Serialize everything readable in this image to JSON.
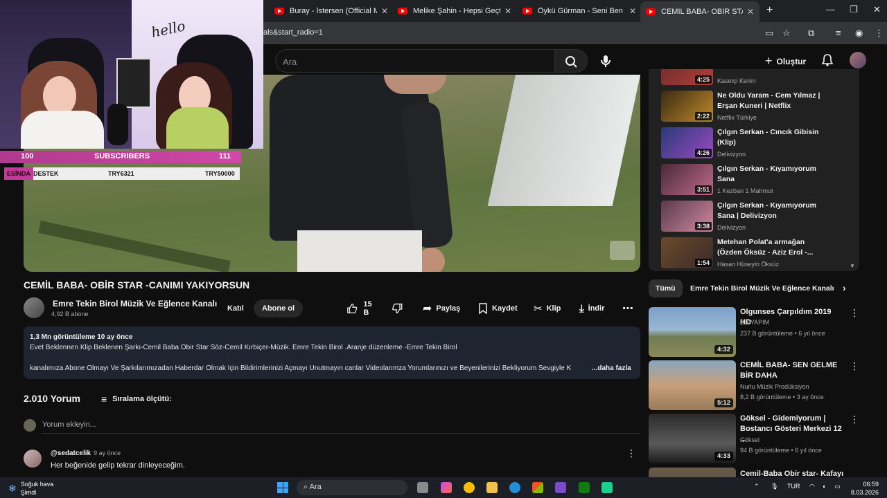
{
  "browser": {
    "tabs": [
      {
        "title": "Buray - İstersen (Official Music Video)"
      },
      {
        "title": "Melike Şahin - Hepsi Geçti | Karnaval"
      },
      {
        "title": "Öykü Gürman - Seni Ben Unutmam"
      },
      {
        "title": "CEMİL BABA- OBİR STAR -CANIMI"
      }
    ],
    "url": "als&start_radio=1"
  },
  "masthead": {
    "search_placeholder": "Ara",
    "create_label": "Oluştur"
  },
  "stream_overlay": {
    "hello_text": "hello",
    "subs_left": "100",
    "subs_label": "SUBSCRIBERS",
    "subs_right": "111",
    "destek_label": "ESİNDA",
    "destek_title": "DESTEK",
    "destek_mid": "TRY6321",
    "destek_right": "TRY50000"
  },
  "video": {
    "title": "CEMİL BABA- OBİR STAR -CANIMI YAKIYORSUN",
    "channel": "Emre Tekin Birol Müzik Ve Eğlence Kanalı",
    "subscribers": "4,92 B abone",
    "join_label": "Katıl",
    "subscribe_label": "Abone ol",
    "likes": "15 B",
    "share_label": "Paylaş",
    "save_label": "Kaydet",
    "clip_label": "Klip",
    "download_label": "İndir"
  },
  "description": {
    "meta": "1,3 Mn görüntüleme  10 ay önce",
    "line1": "Evet Beklennen Klip Beklenen Şarkı-Cemil Baba Obir Star Söz-Cemil Kırbiçer-Müzik. Emre Tekin Birol .Aranje düzenleme -Emre Tekin Birol",
    "line2": "kanalımıza Abone Olmayı Ve Şarkılarımızadan Haberdar Olmak İçin Bildirimlerinizi Açmayı Unutmayın canlar Videolarımza Yorumlarınızı ve Beyenilerinizi Bekliyorum Sevgiyle K",
    "more": "...daha fazla"
  },
  "comments": {
    "count": "2.010 Yorum",
    "sort_label": "Sıralama ölçütü:",
    "add_placeholder": "Yorum ekleyin...",
    "items": [
      {
        "user": "@sedatcelik",
        "time": "9 ay önce",
        "text": "Her beğenide gelip tekrar dinleyeceğim."
      }
    ]
  },
  "mix": {
    "items": [
      {
        "title": "",
        "channel": "Kasetçi Kerim",
        "duration": "4:25"
      },
      {
        "title": "Ne Oldu Yaram - Cem Yılmaz | Erşan Kuneri | Netflix",
        "channel": "Netflix Türkiye",
        "duration": "2:22"
      },
      {
        "title": "Çılgın Serkan - Cıncık Gibisin (Klip)",
        "channel": "Delivizyon",
        "duration": "4:26"
      },
      {
        "title": "Çılgın Serkan - Kıyamıyorum Sana",
        "channel": "1 Kezban 1 Mahmut",
        "duration": "3:51"
      },
      {
        "title": "Çılgın Serkan - Kıyamıyorum Sana | Delivizyon",
        "channel": "Delivizyon",
        "duration": "3:38"
      },
      {
        "title": "Metehan Polat'a armağan (Özden Öksüz - Aziz Erol -...",
        "channel": "Hasan Hüseyin Öksüz",
        "duration": "1:54"
      }
    ]
  },
  "chips": {
    "all": "Tümü",
    "channel": "Emre Tekin Birol Müzik Ve Eğlence Kanalı"
  },
  "recommendations": [
    {
      "title": "Olgunses Çarpıldım  2019 HD",
      "channel": "SH YAPIM",
      "meta": "237 B görüntüleme  •  6 yıl önce",
      "duration": "4:32"
    },
    {
      "title": "CEMİL BABA- SEN GELME BİR DAHA",
      "channel": "Nurlu Müzik Prodüksiyon",
      "meta": "8,2 B görüntüleme  •  3 ay önce",
      "duration": "5:12"
    },
    {
      "title": "Göksel - Gidemiyorum | Bostancı Gösteri Merkezi 12 ...",
      "channel": "Göksel",
      "meta": "94 B görüntüleme  •  6 yıl önce",
      "duration": "4:33"
    },
    {
      "title": "Cemil-Baba Obir star-  Kafayı",
      "channel": "",
      "meta": "",
      "duration": ""
    }
  ],
  "taskbar": {
    "weather_title": "Soğuk hava",
    "weather_sub": "Şimdi",
    "search": "Ara",
    "lang": "TUR",
    "time": "06:59",
    "date": "8.03.2026"
  }
}
